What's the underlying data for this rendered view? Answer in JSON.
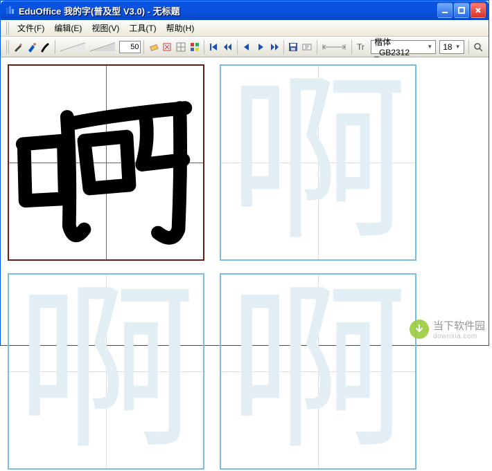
{
  "title": "EduOffice 我的字(普及型 V3.0) - 无标题",
  "menu": {
    "file": "文件(F)",
    "edit": "编辑(E)",
    "view": "视图(V)",
    "tools": "工具(T)",
    "help": "帮助(H)"
  },
  "toolbar": {
    "brush_size": "50",
    "font_name": "楷体_GB2312",
    "font_size": "18"
  },
  "practice_char": "啊",
  "watermark": {
    "brand": "当下软件园",
    "url": "downxia.com"
  }
}
